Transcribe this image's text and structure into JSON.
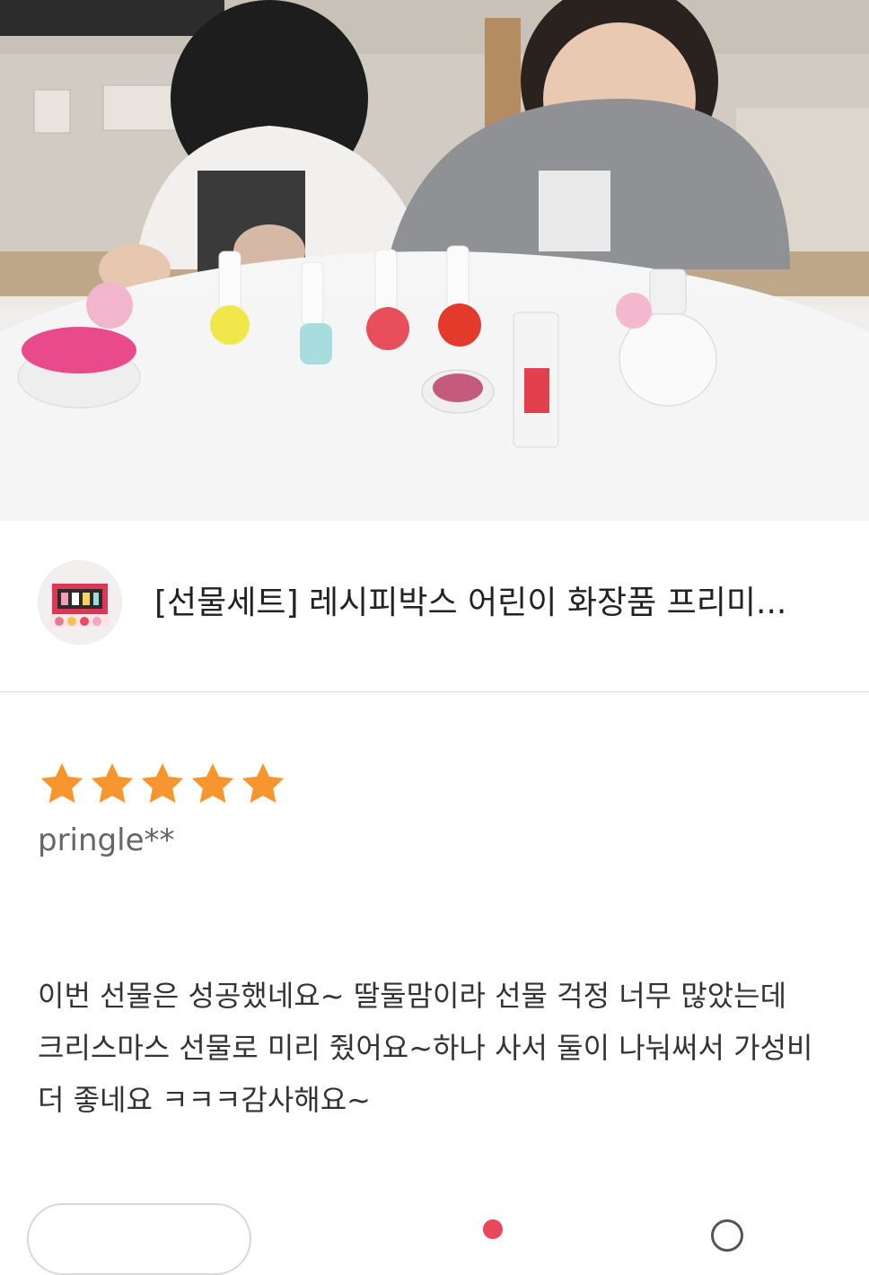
{
  "photo": {
    "icon": "review-photo"
  },
  "product": {
    "title": "[선물세트] 레시피박스 어린이 화장품 프리미...",
    "thumb_icon": "product-gift-set-thumbnail"
  },
  "review": {
    "rating": 5,
    "rating_max": 5,
    "star_color": "#F7962F",
    "reviewer": "pringle**",
    "lines": [
      "이번 선물은 성공했네요~ 딸둘맘이라 선물 걱정 너무 많았는데",
      "크리스마스 선물로 미리 줬어요~하나 사서 둘이 나눠써서 가성비",
      "더 좋네요 ㅋㅋㅋ감사해요~"
    ]
  },
  "actions": {
    "heart_color": "#E9485C"
  }
}
